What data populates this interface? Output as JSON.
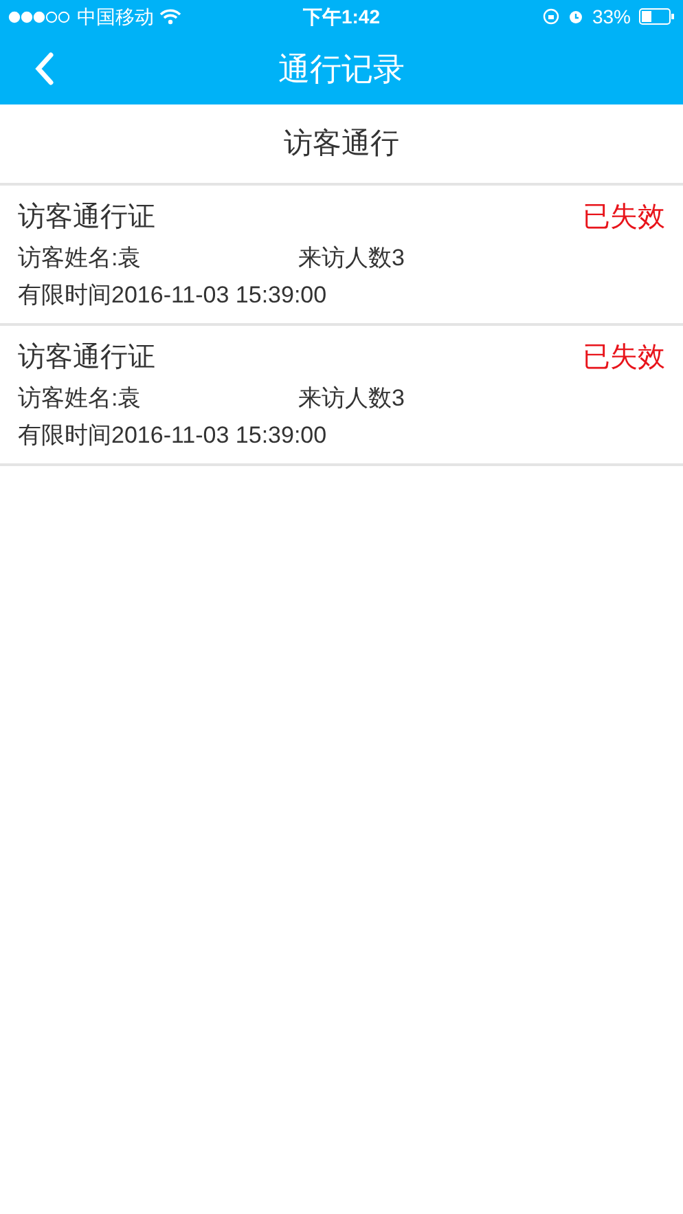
{
  "status_bar": {
    "carrier": "中国移动",
    "time": "下午1:42",
    "battery": "33%"
  },
  "nav": {
    "title": "通行记录"
  },
  "section": {
    "title": "访客通行"
  },
  "records": [
    {
      "title": "访客通行证",
      "status": "已失效",
      "kind": "expired",
      "visitor": "访客姓名:袁",
      "count": "来访人数3",
      "time": "有限时间2016-11-03 15:39:00"
    },
    {
      "title": "访客通行证",
      "status": "已失效",
      "kind": "expired",
      "visitor": "访客姓名:袁",
      "count": "来访人数3",
      "time": "有限时间2016-11-03 15:39:00"
    }
  ]
}
